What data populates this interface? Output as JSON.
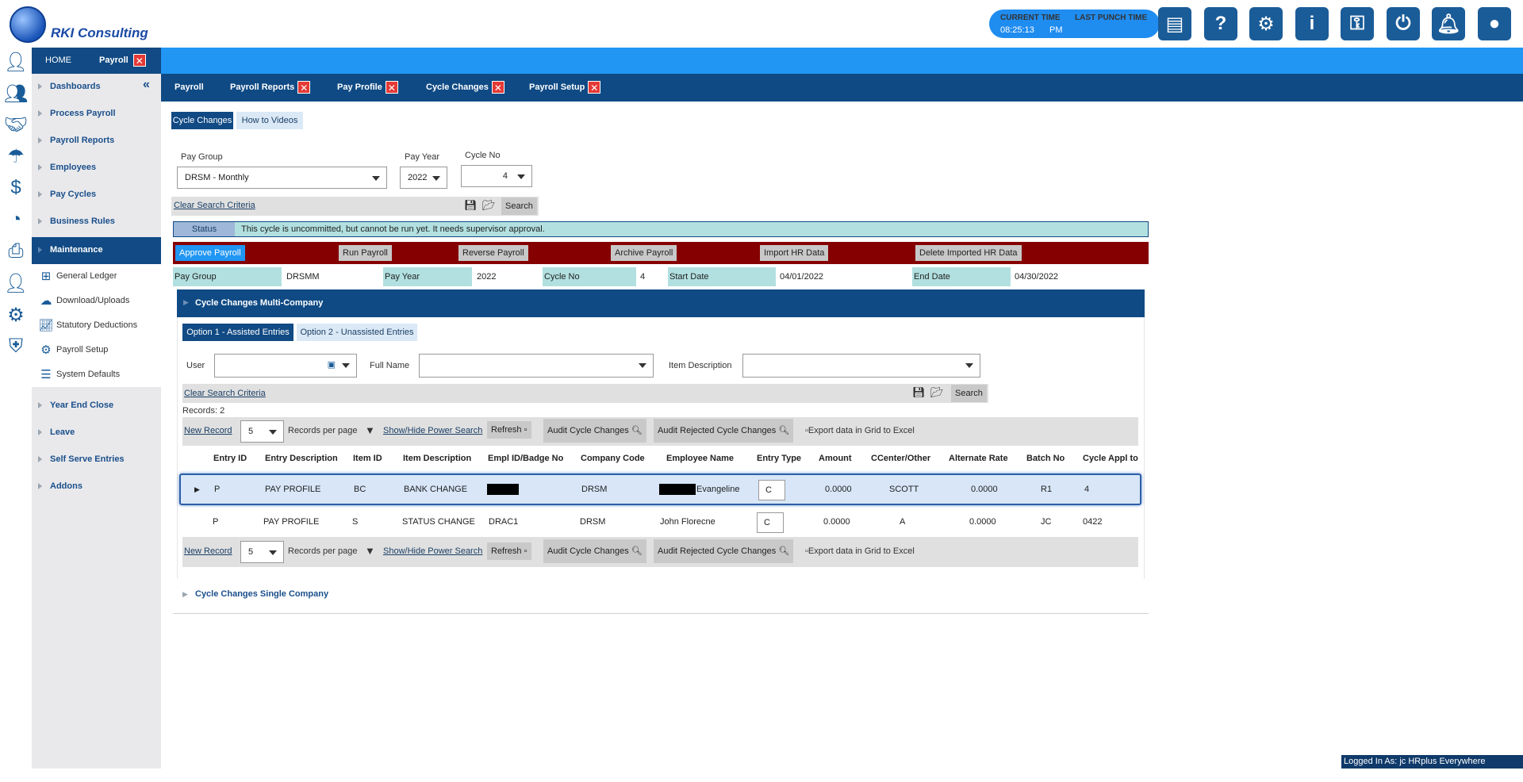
{
  "header": {
    "brand": "RKI Consulting",
    "current_time_label": "CURRENT TIME",
    "current_time_value": "08:25:13",
    "last_punch_label": "LAST PUNCH TIME",
    "last_punch_value": "PM"
  },
  "topnav": {
    "home": "HOME",
    "payroll": "Payroll",
    "close": "✕"
  },
  "sidebar": {
    "items": [
      {
        "label": "Dashboards"
      },
      {
        "label": "Process Payroll"
      },
      {
        "label": "Payroll Reports"
      },
      {
        "label": "Employees"
      },
      {
        "label": "Pay Cycles"
      },
      {
        "label": "Business Rules"
      },
      {
        "label": "Maintenance"
      }
    ],
    "sub_items": [
      {
        "label": "General Ledger"
      },
      {
        "label": "Download/Uploads"
      },
      {
        "label": "Statutory Deductions"
      },
      {
        "label": "Payroll Setup"
      },
      {
        "label": "System Defaults"
      }
    ],
    "lower_items": [
      {
        "label": "Year End Close"
      },
      {
        "label": "Leave"
      },
      {
        "label": "Self Serve Entries"
      },
      {
        "label": "Addons"
      }
    ]
  },
  "subnav": {
    "tabs": [
      {
        "label": "Payroll"
      },
      {
        "label": "Payroll Reports"
      },
      {
        "label": "Pay Profile"
      },
      {
        "label": "Cycle Changes"
      },
      {
        "label": "Payroll Setup"
      }
    ],
    "close": "✕"
  },
  "page_tabs": {
    "cycle_changes": "Cycle Changes",
    "how_to": "How to Videos"
  },
  "search": {
    "pay_group_label": "Pay Group",
    "pay_group_value": "DRSM - Monthly",
    "pay_year_label": "Pay Year",
    "pay_year_value": "2022",
    "cycle_no_label": "Cycle No",
    "cycle_no_value": "4",
    "clear": "Clear Search Criteria",
    "search_btn": "Search"
  },
  "status": {
    "label": "Status",
    "message": "This cycle is uncommitted, but cannot be run yet. It needs supervisor approval."
  },
  "actions": {
    "approve": "Approve Payroll",
    "run": "Run Payroll",
    "reverse": "Reverse Payroll",
    "archive": "Archive Payroll",
    "import": "Import HR Data",
    "delete": "Delete Imported HR Data"
  },
  "info": {
    "pay_group_label": "Pay Group",
    "pay_group_value": "DRSMM",
    "pay_year_label": "Pay Year",
    "pay_year_value": "2022",
    "cycle_no_label": "Cycle No",
    "cycle_no_value": "4",
    "start_label": "Start Date",
    "start_value": "04/01/2022",
    "end_label": "End Date",
    "end_value": "04/30/2022"
  },
  "multi": {
    "title": "Cycle Changes Multi-Company",
    "opt1": "Option 1 - Assisted Entries",
    "opt2": "Option 2 - Unassisted Entries",
    "user_label": "User",
    "fullname_label": "Full Name",
    "itemdesc_label": "Item Description",
    "clear": "Clear Search Criteria",
    "search_btn": "Search",
    "records": "Records:  2",
    "new_record": "New Record",
    "per_page_value": "5",
    "per_page_label": "Records per page",
    "power_search": "Show/Hide Power Search",
    "refresh": "Refresh",
    "audit": "Audit Cycle Changes",
    "audit_rejected": "Audit Rejected Cycle Changes",
    "export": "Export data in Grid to Excel"
  },
  "table": {
    "headers": [
      "Entry ID",
      "Entry Description",
      "Item ID",
      "Item Description",
      "Empl ID/Badge No",
      "Company Code",
      "Employee Name",
      "Entry Type",
      "Amount",
      "CCenter/Other",
      "Alternate Rate",
      "Batch No",
      "Cycle Appl to"
    ],
    "rows": [
      {
        "entry_id": "P",
        "entry_desc": "PAY PROFILE",
        "item_id": "BC",
        "item_desc": "BANK CHANGE",
        "empl_id": "",
        "company": "DRSM",
        "emp_name": "Evangeline",
        "entry_type": "C",
        "amount": "0.0000",
        "ccenter": "SCOTT",
        "alt_rate": "0.0000",
        "batch": "R1",
        "cycle": "4"
      },
      {
        "entry_id": "P",
        "entry_desc": "PAY PROFILE",
        "item_id": "S",
        "item_desc": "STATUS CHANGE",
        "empl_id": "DRAC1",
        "company": "DRSM",
        "emp_name": "John Florecne",
        "entry_type": "C",
        "amount": "0.0000",
        "ccenter": "A",
        "alt_rate": "0.0000",
        "batch": "JC",
        "cycle": "0422"
      }
    ]
  },
  "single": {
    "title": "Cycle Changes Single Company"
  },
  "footer": {
    "logged_in": "Logged In As: jc HRplus Everywhere Enterprise"
  }
}
